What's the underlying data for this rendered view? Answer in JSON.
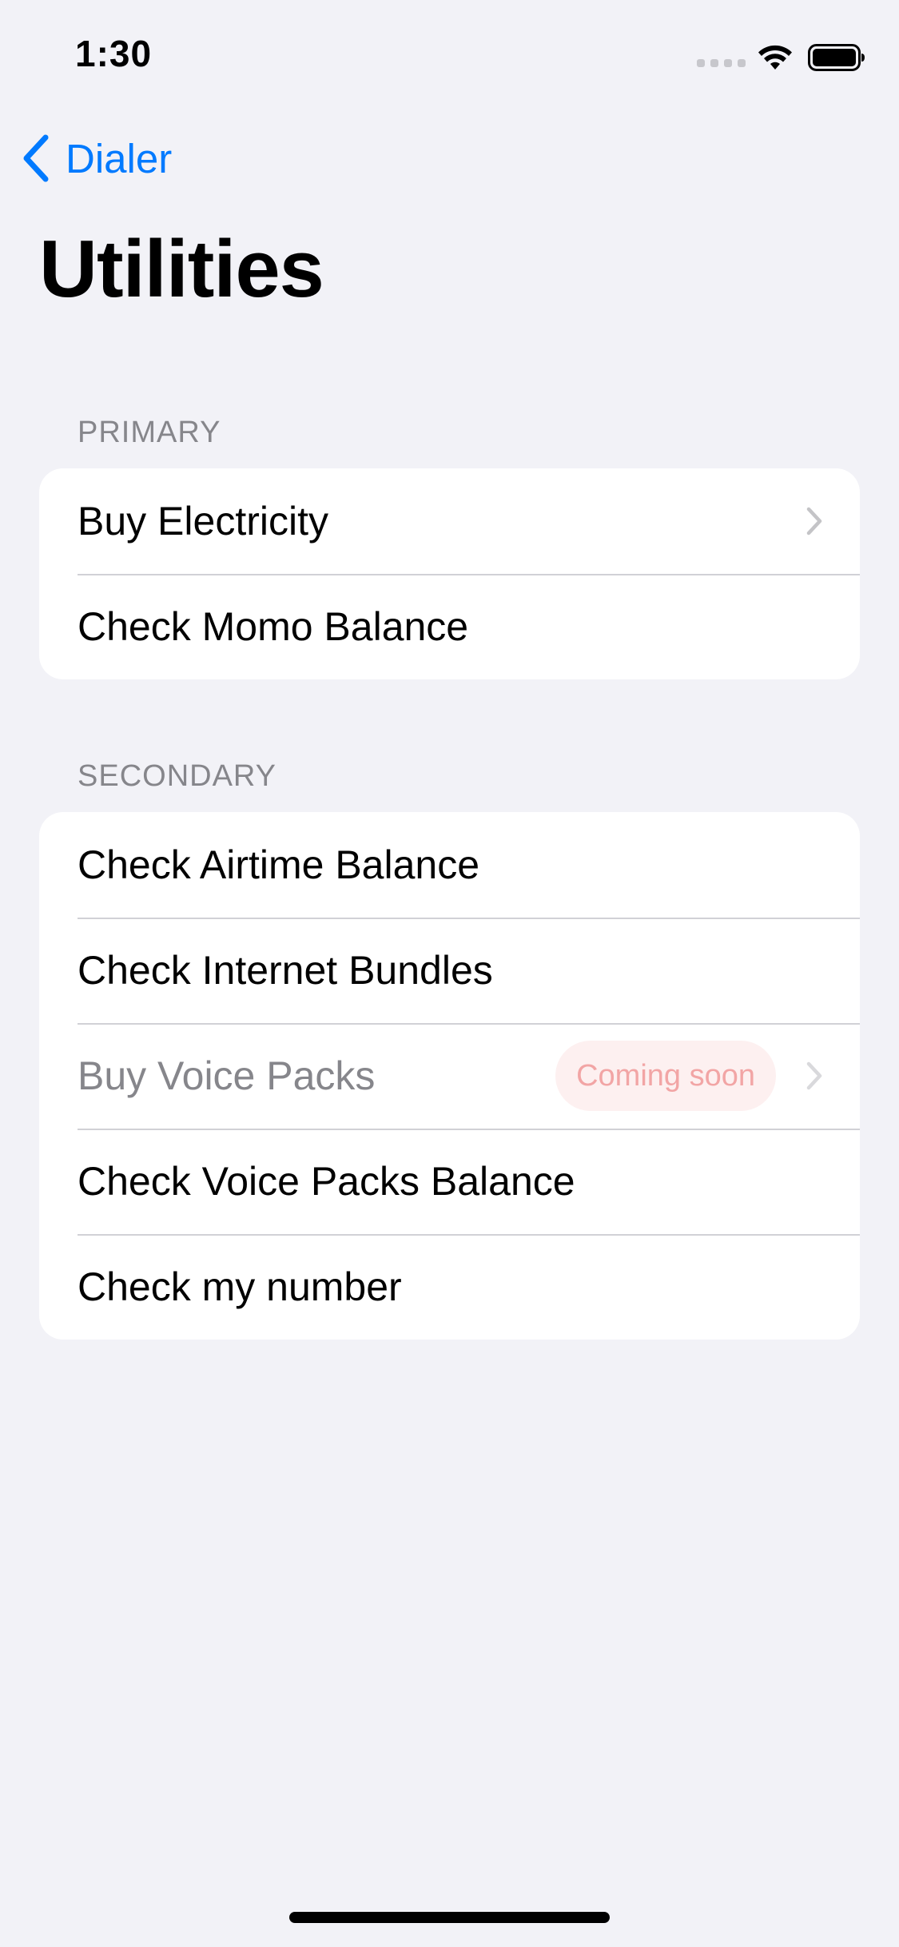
{
  "status_bar": {
    "time": "1:30"
  },
  "nav": {
    "back_label": "Dialer",
    "title": "Utilities"
  },
  "sections": [
    {
      "header": "PRIMARY",
      "items": [
        {
          "label": "Buy Electricity",
          "chevron": true,
          "disabled": false
        },
        {
          "label": "Check Momo Balance",
          "chevron": false,
          "disabled": false
        }
      ]
    },
    {
      "header": "SECONDARY",
      "items": [
        {
          "label": "Check Airtime Balance",
          "chevron": false,
          "disabled": false
        },
        {
          "label": "Check Internet Bundles",
          "chevron": false,
          "disabled": false
        },
        {
          "label": "Buy Voice Packs",
          "chevron": true,
          "disabled": true,
          "badge": "Coming soon"
        },
        {
          "label": "Check Voice Packs Balance",
          "chevron": false,
          "disabled": false
        },
        {
          "label": "Check my number",
          "chevron": false,
          "disabled": false
        }
      ]
    }
  ],
  "colors": {
    "accent": "#007aff",
    "background": "#f2f2f7",
    "badge_bg": "#fdf0f0",
    "badge_text": "#f2a5a5"
  }
}
